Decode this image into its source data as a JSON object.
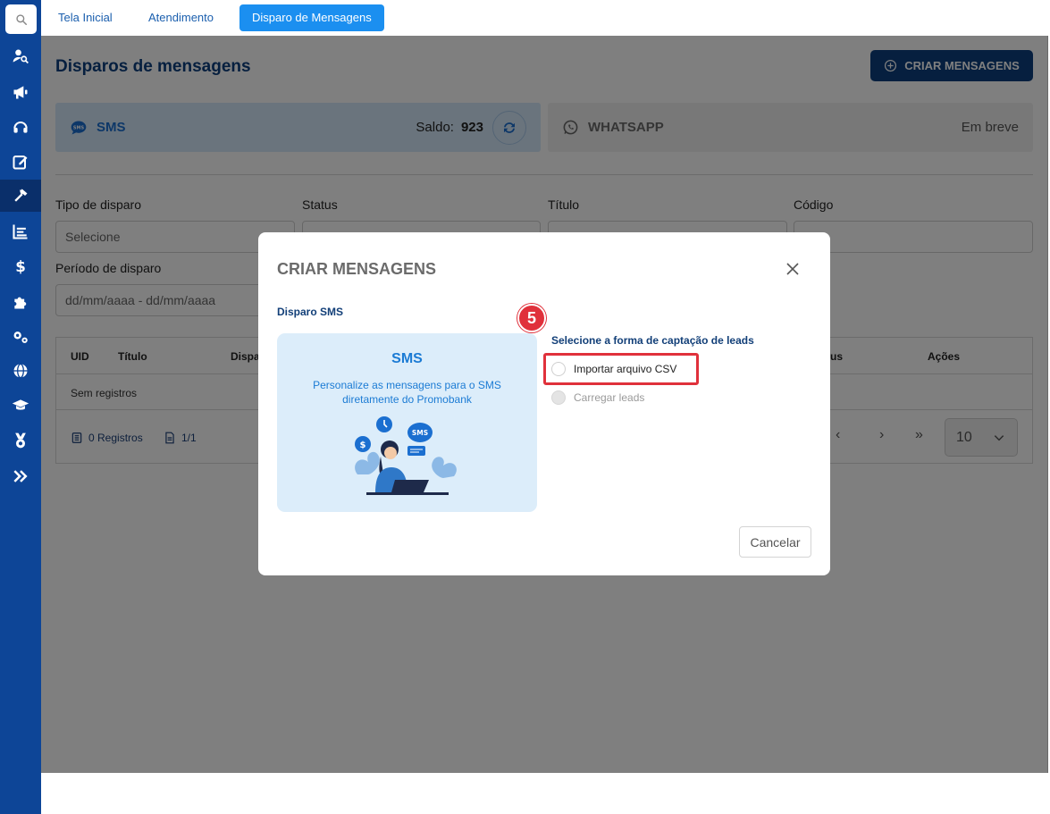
{
  "tabs": [
    {
      "label": "Tela Inicial"
    },
    {
      "label": "Atendimento"
    },
    {
      "label": "Disparo de Mensagens"
    }
  ],
  "sidebar": {
    "items": [
      {
        "icon": "search-icon"
      },
      {
        "icon": "user-search-icon"
      },
      {
        "icon": "megaphone-icon"
      },
      {
        "icon": "headset-icon"
      },
      {
        "icon": "edit-icon"
      },
      {
        "icon": "hammer-icon",
        "active": true
      },
      {
        "icon": "chart-icon"
      },
      {
        "icon": "dollar-icon"
      },
      {
        "icon": "puzzle-icon"
      },
      {
        "icon": "gears-icon"
      },
      {
        "icon": "globe-icon"
      },
      {
        "icon": "graduation-cap-icon"
      },
      {
        "icon": "medal-icon"
      },
      {
        "icon": "expand-icon"
      }
    ]
  },
  "page": {
    "title": "Disparos de mensagens",
    "create_button": "CRIAR MENSAGENS"
  },
  "channels": {
    "sms": {
      "label": "SMS",
      "saldo_label": "Saldo:",
      "saldo_value": "923"
    },
    "whatsapp": {
      "label": "WHATSAPP",
      "status": "Em breve"
    }
  },
  "filters": {
    "tipo_label": "Tipo de disparo",
    "tipo_placeholder": "Selecione",
    "status_label": "Status",
    "titulo_label": "Título",
    "codigo_label": "Código",
    "periodo_label": "Período de disparo",
    "periodo_placeholder": "dd/mm/aaaa - dd/mm/aaaa"
  },
  "table": {
    "columns": [
      "UID",
      "Título",
      "Dispa",
      "us",
      "Ações"
    ],
    "empty": "Sem registros",
    "registros": "0 Registros",
    "pages": "1/1",
    "page_size": "10"
  },
  "modal": {
    "title": "CRIAR MENSAGENS",
    "subtitle": "Disparo SMS",
    "card_title": "SMS",
    "card_desc": "Personalize as mensagens para o SMS diretamente do Promobank",
    "illus_bubble": "SMS",
    "leads_title": "Selecione a forma de captação de leads",
    "options": [
      {
        "label": "Importar arquivo CSV",
        "enabled": true
      },
      {
        "label": "Carregar leads",
        "enabled": false
      }
    ],
    "step_number": "5",
    "cancel": "Cancelar"
  },
  "colors": {
    "sidebar": "#0d4597",
    "primary": "#0d3f7f",
    "accent": "#1b8ff0",
    "highlight": "#e0313b"
  }
}
